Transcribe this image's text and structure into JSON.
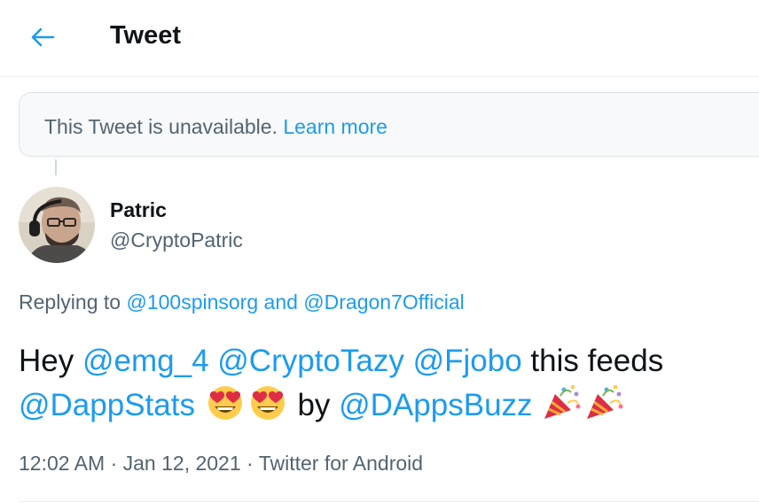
{
  "header": {
    "back_icon": "arrow-left-icon",
    "title": "Tweet"
  },
  "notice": {
    "text": "This Tweet is unavailable.",
    "link": "Learn more"
  },
  "author": {
    "name": "Patric",
    "handle": "@CryptoPatric",
    "avatar_icon": "profile-photo"
  },
  "reply": {
    "prefix": "Replying to",
    "mention1": "@100spinsorg",
    "conjunction": "and",
    "mention2": "@Dragon7Official"
  },
  "tweet": {
    "word_hey": "Hey",
    "mention_emg": "@emg_4",
    "mention_cryptotazy": "@CryptoTazy",
    "mention_fjobo": "@Fjobo",
    "text_feeds": "this feeds",
    "mention_dappstats": "@DappStats",
    "word_by": "by",
    "mention_dappsbuzz": "@DAppsBuzz",
    "emojis": [
      "heart-eyes-icon",
      "heart-eyes-icon",
      "party-popper-icon",
      "party-popper-icon"
    ]
  },
  "meta": {
    "time": "12:02 AM",
    "separator": "·",
    "date": "Jan 12, 2021",
    "source": "Twitter for Android"
  },
  "colors": {
    "link": "#1d9bf0",
    "text": "#0f1419",
    "secondary": "#536471",
    "border": "#ebeef0"
  }
}
